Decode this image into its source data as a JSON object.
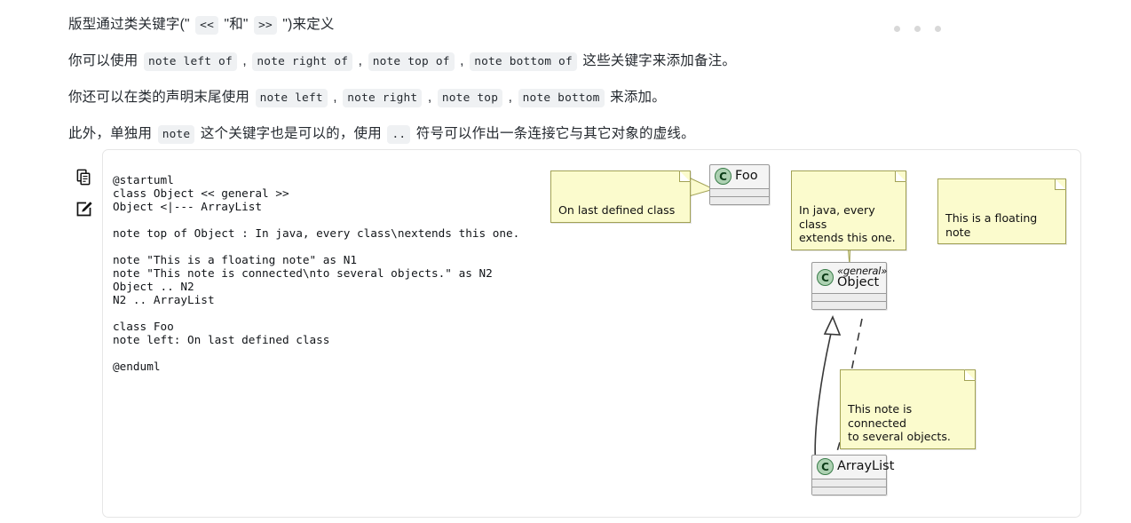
{
  "document": {
    "paragraphs": [
      {
        "id": "p1",
        "parts": [
          {
            "type": "text",
            "value": "版型通过类关键字(\" "
          },
          {
            "type": "code",
            "value": "<<"
          },
          {
            "type": "text",
            "value": " \"和\" "
          },
          {
            "type": "code",
            "value": ">>"
          },
          {
            "type": "text",
            "value": " \")来定义"
          }
        ]
      },
      {
        "id": "p2",
        "parts": [
          {
            "type": "text",
            "value": "你可以使用 "
          },
          {
            "type": "code",
            "value": "note left of"
          },
          {
            "type": "text",
            "value": " , "
          },
          {
            "type": "code",
            "value": "note right of"
          },
          {
            "type": "text",
            "value": " , "
          },
          {
            "type": "code",
            "value": "note top of"
          },
          {
            "type": "text",
            "value": " , "
          },
          {
            "type": "code",
            "value": "note bottom of"
          },
          {
            "type": "text",
            "value": " 这些关键字来添加备注。"
          }
        ]
      },
      {
        "id": "p3",
        "parts": [
          {
            "type": "text",
            "value": "你还可以在类的声明末尾使用 "
          },
          {
            "type": "code",
            "value": "note left"
          },
          {
            "type": "text",
            "value": " , "
          },
          {
            "type": "code",
            "value": "note right"
          },
          {
            "type": "text",
            "value": " , "
          },
          {
            "type": "code",
            "value": "note top"
          },
          {
            "type": "text",
            "value": " , "
          },
          {
            "type": "code",
            "value": "note bottom"
          },
          {
            "type": "text",
            "value": " 来添加。"
          }
        ]
      },
      {
        "id": "p4",
        "parts": [
          {
            "type": "text",
            "value": "此外，单独用 "
          },
          {
            "type": "code",
            "value": "note"
          },
          {
            "type": "text",
            "value": " 这个关键字也是可以的，使用 "
          },
          {
            "type": "code",
            "value": ".."
          },
          {
            "type": "text",
            "value": " 符号可以作出一条连接它与其它对象的虚线。"
          }
        ]
      }
    ]
  },
  "menu": {
    "dots_label": "更多操作",
    "dot_count": 3
  },
  "card": {
    "toolbar": [
      {
        "name": "copy-icon",
        "label": "复制"
      },
      {
        "name": "edit-icon",
        "label": "编辑"
      }
    ],
    "source": "@startuml\nclass Object << general >>\nObject <|--- ArrayList\n\nnote top of Object : In java, every class\\nextends this one.\n\nnote \"This is a floating note\" as N1\nnote \"This note is connected\\nto several objects.\" as N2\nObject .. N2\nN2 .. ArrayList\n\nclass Foo\nnote left: On last defined class\n\n@enduml"
  },
  "diagram": {
    "type": "plantuml-class-diagram",
    "colors": {
      "class_fill": "#F4F4F4",
      "class_border": "#9A9A9A",
      "class_marker_fill": "#ADD1B2",
      "class_marker_border": "#3A7D4A",
      "note_fill": "#FBFBCD",
      "note_border": "#A2A255",
      "link_color": "#383838"
    },
    "classes": [
      {
        "id": "Foo",
        "name": "Foo",
        "stereotype": "",
        "marker": "C"
      },
      {
        "id": "Object",
        "name": "Object",
        "stereotype": "«general»",
        "marker": "C"
      },
      {
        "id": "ArrayList",
        "name": "ArrayList",
        "stereotype": "",
        "marker": "C"
      }
    ],
    "notes": [
      {
        "id": "note-foo",
        "text": "On last defined class",
        "attached_to": "Foo"
      },
      {
        "id": "note-object",
        "text": "In java, every class\nextends this one.",
        "attached_to": "Object"
      },
      {
        "id": "note-floating",
        "text": "This is a floating note",
        "attached_to": ""
      },
      {
        "id": "note-connected",
        "text": "This note is connected\nto several objects.",
        "attached_to": "Object, ArrayList"
      }
    ],
    "relations": [
      {
        "from": "ArrayList",
        "to": "Object",
        "type": "generalization",
        "style": "solid"
      },
      {
        "from": "Object",
        "to": "note-connected",
        "type": "link",
        "style": "dashed"
      },
      {
        "from": "note-connected",
        "to": "ArrayList",
        "type": "link",
        "style": "dashed"
      }
    ]
  }
}
